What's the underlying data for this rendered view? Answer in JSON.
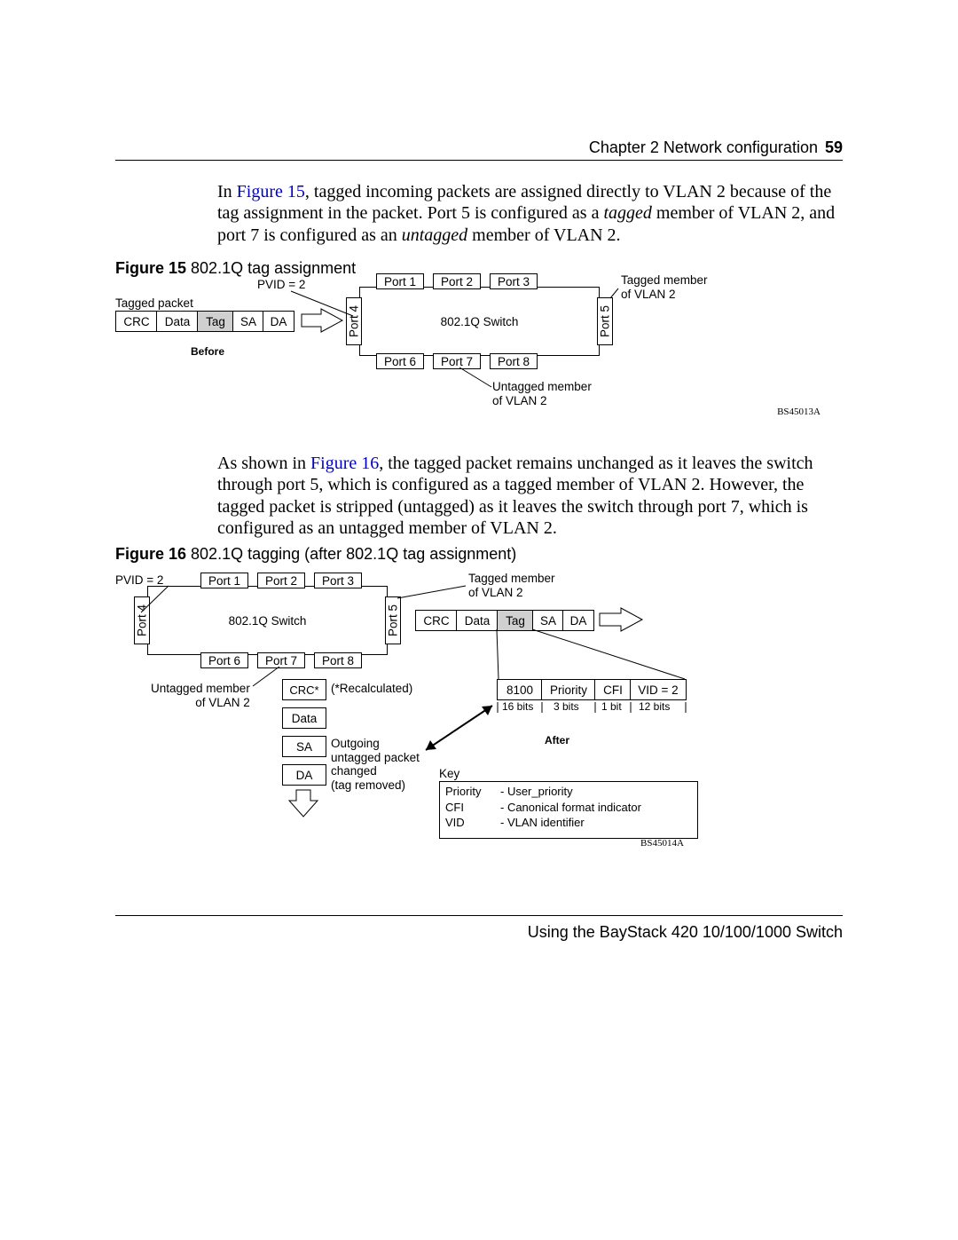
{
  "header": {
    "chapter": "Chapter 2  Network configuration",
    "page": "59"
  },
  "para1": {
    "pre": "In ",
    "figref": "Figure 15",
    "post1": ", tagged incoming packets are assigned directly to VLAN 2 because of the tag assignment in the packet. Port 5 is configured as a ",
    "tagged": "tagged",
    "post2": " member of VLAN 2, and port 7 is configured as an ",
    "untagged": "untagged",
    "post3": " member of VLAN 2."
  },
  "fig15": {
    "caption_bold": "Figure 15",
    "caption_rest": "   802.1Q tag assignment",
    "pvid": "PVID = 2",
    "tagged_packet": "Tagged packet",
    "packet": {
      "crc": "CRC",
      "data": "Data",
      "tag": "Tag",
      "sa": "SA",
      "da": "DA"
    },
    "before": "Before",
    "switch_label": "802.1Q Switch",
    "ports": {
      "p1": "Port 1",
      "p2": "Port 2",
      "p3": "Port 3",
      "p4": "Port 4",
      "p5": "Port 5",
      "p6": "Port 6",
      "p7": "Port 7",
      "p8": "Port 8"
    },
    "tagged_member": "Tagged member\nof VLAN 2",
    "untagged_member": "Untagged member\nof VLAN 2",
    "figno": "BS45013A"
  },
  "para2": {
    "pre": "As shown in ",
    "figref": "Figure 16",
    "post": ", the tagged packet remains unchanged as it leaves the switch through port 5, which is configured as a tagged member of VLAN 2. However, the tagged packet is stripped (untagged) as it leaves the switch through port 7, which is configured as an untagged member of VLAN 2."
  },
  "fig16": {
    "caption_bold": "Figure 16",
    "caption_rest": "   802.1Q tagging (after 802.1Q tag assignment)",
    "pvid": "PVID = 2",
    "switch_label": "802.1Q Switch",
    "ports": {
      "p1": "Port 1",
      "p2": "Port 2",
      "p3": "Port 3",
      "p4": "Port 4",
      "p5": "Port 5",
      "p6": "Port 6",
      "p7": "Port 7",
      "p8": "Port 8"
    },
    "tagged_member": "Tagged member\nof VLAN 2",
    "untagged_member": "Untagged member\nof VLAN 2",
    "packet": {
      "crc": "CRC",
      "data": "Data",
      "tag": "Tag",
      "sa": "SA",
      "da": "DA"
    },
    "untagged_packet": {
      "crc": "CRC*",
      "data": "Data",
      "sa": "SA",
      "da": "DA"
    },
    "recalc": "(*Recalculated)",
    "outgoing": "Outgoing\nuntagged packet\nchanged\n(tag removed)",
    "tag_fields": {
      "tpid": "8100",
      "priority": "Priority",
      "cfi": "CFI",
      "vid": "VID = 2"
    },
    "tag_bits": {
      "tpid": "16 bits",
      "priority": "3 bits",
      "cfi": "1 bit",
      "vid": "12 bits"
    },
    "after": "After",
    "key_title": "Key",
    "key": {
      "k1l": "Priority",
      "k1r": "- User_priority",
      "k2l": "CFI",
      "k2r": "- Canonical format indicator",
      "k3l": "VID",
      "k3r": "- VLAN identifier"
    },
    "figno": "BS45014A"
  },
  "footer": "Using the BayStack 420 10/100/1000 Switch"
}
